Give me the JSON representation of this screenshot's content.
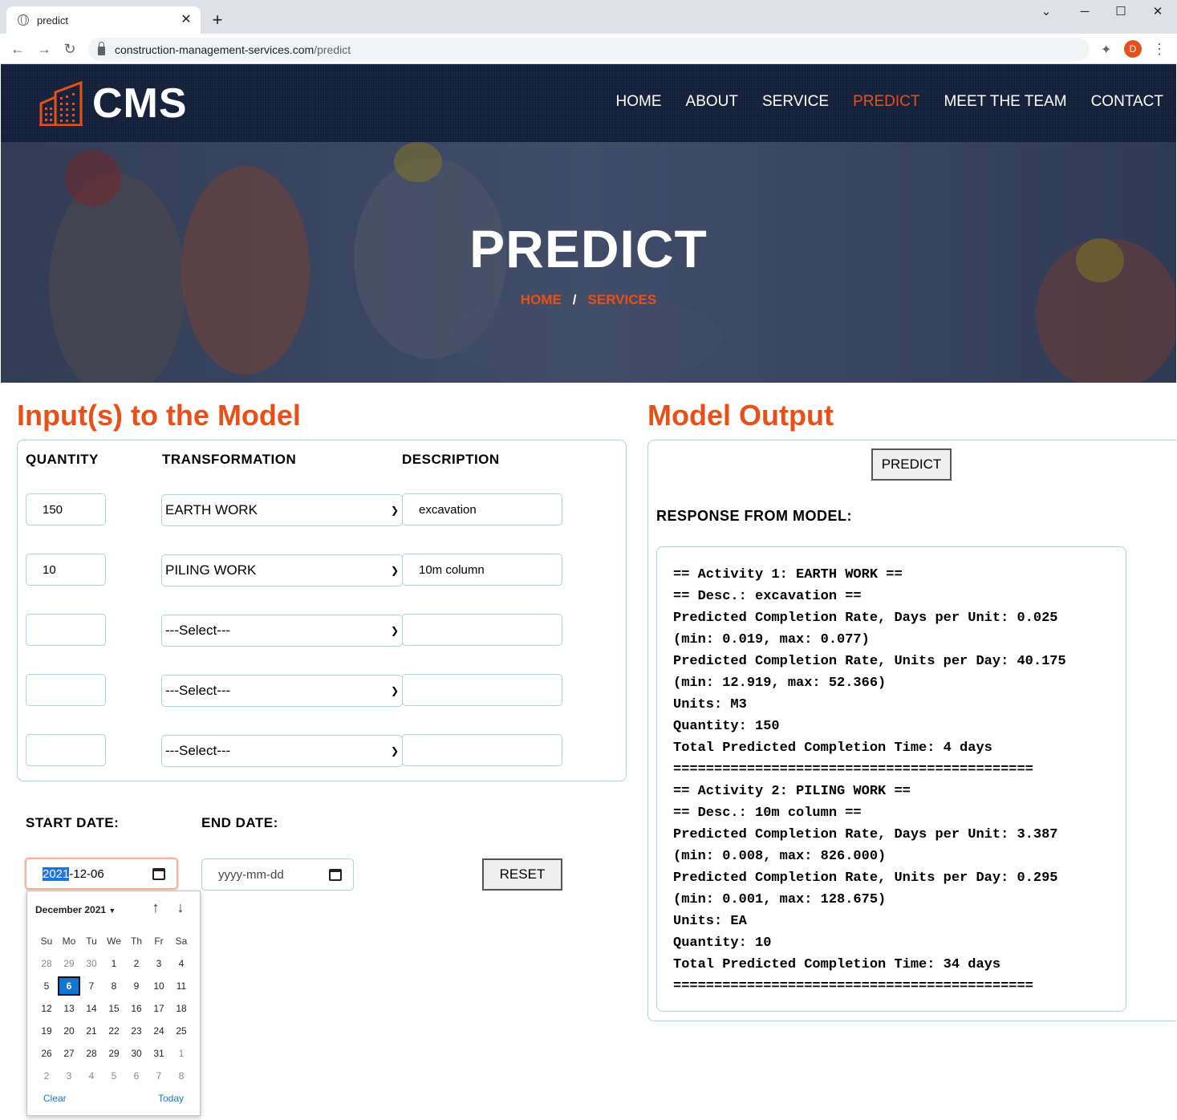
{
  "browser": {
    "tab_title": "predict",
    "url_domain": "construction-management-services.com",
    "url_path": "/predict",
    "profile_initial": "D"
  },
  "site": {
    "logo_text": "CMS",
    "nav": [
      "HOME",
      "ABOUT",
      "SERVICE",
      "PREDICT",
      "MEET THE TEAM",
      "CONTACT"
    ],
    "active_nav": "PREDICT",
    "accent_color": "#e8501a",
    "header_color": "#131f39"
  },
  "hero": {
    "title": "PREDICT",
    "crumb_home": "HOME",
    "crumb_sep": "/",
    "crumb_current": "SERVICES"
  },
  "inputs": {
    "section_title": "Input(s) to the Model",
    "col_quantity": "QUANTITY",
    "col_transformation": "TRANSFORMATION",
    "col_description": "DESCRIPTION",
    "rows": [
      {
        "quantity": "150",
        "transformation": "EARTH WORK",
        "description": "excavation"
      },
      {
        "quantity": "10",
        "transformation": "PILING WORK",
        "description": "10m column"
      },
      {
        "quantity": "",
        "transformation": "---Select---",
        "description": ""
      },
      {
        "quantity": "",
        "transformation": "---Select---",
        "description": ""
      },
      {
        "quantity": "",
        "transformation": "---Select---",
        "description": ""
      }
    ],
    "start_date_label": "START DATE:",
    "end_date_label": "END DATE:",
    "start_date_year": "2021",
    "start_date_rest": "-12-06",
    "end_date_placeholder": "yyyy-mm-dd",
    "reset_label": "RESET"
  },
  "calendar": {
    "month_label": "December 2021",
    "weekdays": [
      "Su",
      "Mo",
      "Tu",
      "We",
      "Th",
      "Fr",
      "Sa"
    ],
    "weeks": [
      [
        "28",
        "29",
        "30",
        "1",
        "2",
        "3",
        "4"
      ],
      [
        "5",
        "6",
        "7",
        "8",
        "9",
        "10",
        "11"
      ],
      [
        "12",
        "13",
        "14",
        "15",
        "16",
        "17",
        "18"
      ],
      [
        "19",
        "20",
        "21",
        "22",
        "23",
        "24",
        "25"
      ],
      [
        "26",
        "27",
        "28",
        "29",
        "30",
        "31",
        "1"
      ],
      [
        "2",
        "3",
        "4",
        "5",
        "6",
        "7",
        "8"
      ]
    ],
    "selected_day": "6",
    "clear_label": "Clear",
    "today_label": "Today"
  },
  "output": {
    "section_title": "Model Output",
    "predict_label": "PREDICT",
    "response_label": "RESPONSE FROM MODEL:",
    "lines": [
      "== Activity 1: EARTH WORK ==",
      "== Desc.: excavation ==",
      "Predicted Completion Rate, Days per Unit: 0.025",
      "(min: 0.019, max: 0.077)",
      "Predicted Completion Rate, Units per Day: 40.175",
      "(min: 12.919, max: 52.366)",
      "Units: M3",
      "Quantity: 150",
      "Total Predicted Completion Time: 4 days",
      "============================================",
      "== Activity 2: PILING WORK ==",
      "== Desc.: 10m column ==",
      "Predicted Completion Rate, Days per Unit: 3.387",
      "(min: 0.008, max: 826.000)",
      "Predicted Completion Rate, Units per Day: 0.295",
      "(min: 0.001, max: 128.675)",
      "Units: EA",
      "Quantity: 10",
      "Total Predicted Completion Time: 34 days",
      "============================================"
    ]
  }
}
